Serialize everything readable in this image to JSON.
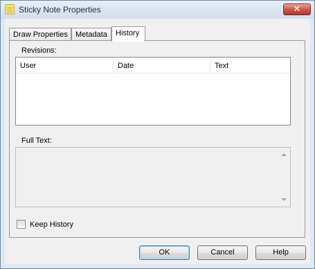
{
  "window": {
    "title": "Sticky Note Properties",
    "close_glyph": "✕"
  },
  "tabs": [
    {
      "label": "Draw Properties",
      "active": false
    },
    {
      "label": "Metadata",
      "active": false
    },
    {
      "label": "History",
      "active": true
    }
  ],
  "history": {
    "revisions_label": "Revisions:",
    "columns": [
      "User",
      "Date",
      "Text"
    ],
    "rows": [],
    "full_text_label": "Full Text:",
    "full_text_value": "",
    "keep_history_label": "Keep History",
    "keep_history_checked": false
  },
  "buttons": {
    "ok": "OK",
    "cancel": "Cancel",
    "help": "Help"
  },
  "icons": {
    "title_icon": "sticky-note-icon",
    "close": "close-icon",
    "scroll_up": "scroll-up-arrow-icon",
    "scroll_down": "scroll-down-arrow-icon"
  }
}
